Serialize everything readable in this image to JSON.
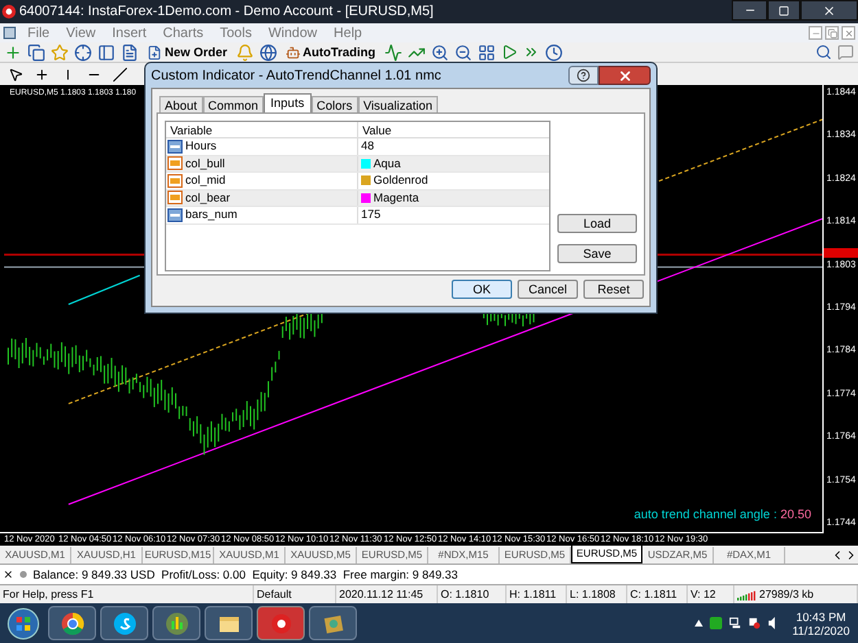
{
  "window": {
    "title": "64007144: InstaForex-1Demo.com - Demo Account - [EURUSD,M5]"
  },
  "menu": [
    "File",
    "View",
    "Insert",
    "Charts",
    "Tools",
    "Window",
    "Help"
  ],
  "toolbar": {
    "new_order": "New Order",
    "auto_trading": "AutoTrading"
  },
  "chart": {
    "header": "EURUSD,M5  1.1803 1.1803 1.180",
    "price_labels": [
      "1.1844",
      "1.1834",
      "1.1824",
      "1.1814",
      "1.1803",
      "1.1794",
      "1.1784",
      "1.1774",
      "1.1764",
      "1.1754",
      "1.1744"
    ],
    "time_labels": [
      "12 Nov 2020",
      "12 Nov 04:50",
      "12 Nov 06:10",
      "12 Nov 07:30",
      "12 Nov 08:50",
      "12 Nov 10:10",
      "12 Nov 11:30",
      "12 Nov 12:50",
      "12 Nov 14:10",
      "12 Nov 15:30",
      "12 Nov 16:50",
      "12 Nov 18:10",
      "12 Nov 19:30"
    ],
    "angle_label": "auto trend channel angle :",
    "angle_value": "20.50"
  },
  "dialog": {
    "title": "Custom Indicator - AutoTrendChannel 1.01 nmc",
    "tabs": [
      {
        "label": "About",
        "selected": false
      },
      {
        "label": "Common",
        "selected": false
      },
      {
        "label": "Inputs",
        "selected": true
      },
      {
        "label": "Colors",
        "selected": false
      },
      {
        "label": "Visualization",
        "selected": false
      }
    ],
    "columns": [
      "Variable",
      "Value"
    ],
    "rows": [
      {
        "kind": "number",
        "name": "Hours",
        "value": "48"
      },
      {
        "kind": "color",
        "name": "col_bull",
        "value": "Aqua",
        "color": "#00ffff"
      },
      {
        "kind": "color",
        "name": "col_mid",
        "value": "Goldenrod",
        "color": "#daa520"
      },
      {
        "kind": "color",
        "name": "col_bear",
        "value": "Magenta",
        "color": "#ff00ff"
      },
      {
        "kind": "number",
        "name": "bars_num",
        "value": "175"
      }
    ],
    "side_buttons": [
      "Load",
      "Save"
    ],
    "buttons": [
      {
        "label": "OK",
        "default": true
      },
      {
        "label": "Cancel",
        "default": false
      },
      {
        "label": "Reset",
        "default": false
      }
    ]
  },
  "chart_tabs": [
    {
      "label": "XAUUSD,M1",
      "selected": false
    },
    {
      "label": "XAUUSD,H1",
      "selected": false
    },
    {
      "label": "EURUSD,M15",
      "selected": false
    },
    {
      "label": "XAUUSD,M1",
      "selected": false
    },
    {
      "label": "XAUUSD,M5",
      "selected": false
    },
    {
      "label": "EURUSD,M5",
      "selected": false
    },
    {
      "label": "#NDX,M15",
      "selected": false
    },
    {
      "label": "EURUSD,M5",
      "selected": false
    },
    {
      "label": "EURUSD,M5",
      "selected": true
    },
    {
      "label": "USDZAR,M5",
      "selected": false
    },
    {
      "label": "#DAX,M1",
      "selected": false
    }
  ],
  "account": "Balance: 9 849.33 USD  Profit/Loss: 0.00  Equity: 9 849.33  Free margin: 9 849.33",
  "status_bar": [
    "For Help, press F1",
    "Default",
    "2020.11.12 11:45",
    "O: 1.1810",
    "H: 1.1811",
    "L: 1.1808",
    "C: 1.1811",
    "V: 12",
    "27989/3 kb"
  ],
  "taskbar": {
    "time": "10:43 PM",
    "date": "11/12/2020"
  }
}
